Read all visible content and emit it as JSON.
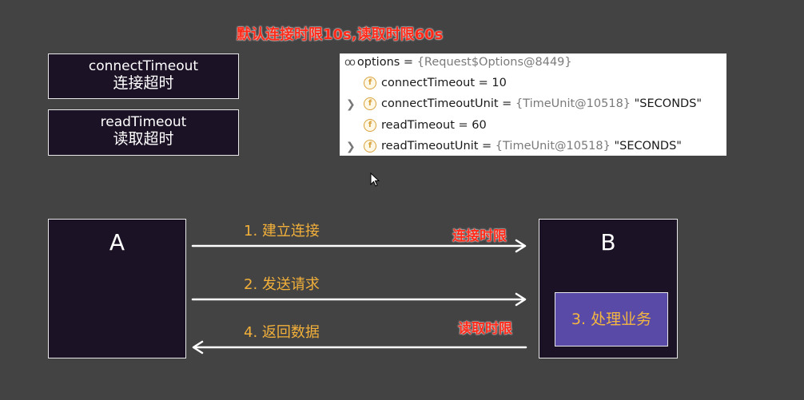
{
  "header": {
    "note": "默认连接时限10s,读取时限60s"
  },
  "terms": {
    "connect": {
      "en": "connectTimeout",
      "zh": "连接超时"
    },
    "read": {
      "en": "readTimeout",
      "zh": "读取超时"
    }
  },
  "debugger": {
    "root": {
      "name": "options",
      "eq": " = ",
      "value": "{Request$Options@8449}"
    },
    "fields": [
      {
        "name": "connectTimeout",
        "eq": " = ",
        "value": "10",
        "extra": "",
        "expandable": false
      },
      {
        "name": "connectTimeoutUnit",
        "eq": " = ",
        "value": "{TimeUnit@10518}",
        "extra": " \"SECONDS\"",
        "expandable": true
      },
      {
        "name": "readTimeout",
        "eq": " = ",
        "value": "60",
        "extra": "",
        "expandable": false
      },
      {
        "name": "readTimeoutUnit",
        "eq": " = ",
        "value": "{TimeUnit@10518}",
        "extra": " \"SECONDS\"",
        "expandable": true
      }
    ],
    "field_badge": "f"
  },
  "diagram": {
    "node_a": "A",
    "node_b": "B",
    "process": "3. 处理业务",
    "steps": [
      "1. 建立连接",
      "2. 发送请求",
      "4. 返回数据"
    ],
    "labels": {
      "connect_limit": "连接时限",
      "read_limit": "读取时限"
    }
  },
  "colors": {
    "background": "#434343",
    "box": "#1c1226",
    "accent_orange": "#f2b03a",
    "accent_red": "#ff2a1a",
    "process_fill": "#5a4aa8"
  }
}
